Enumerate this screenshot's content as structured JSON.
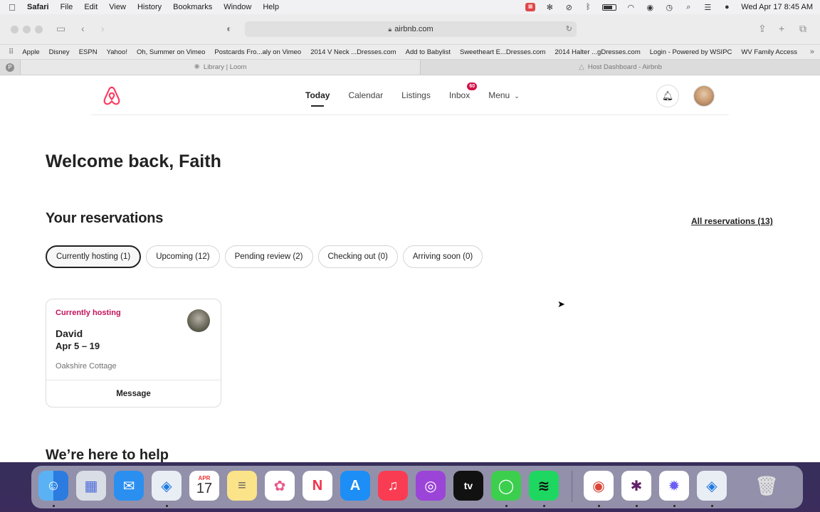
{
  "menubar": {
    "app_name": "Safari",
    "menus": [
      "File",
      "Edit",
      "View",
      "History",
      "Bookmarks",
      "Window",
      "Help"
    ],
    "clock": "Wed Apr 17  8:45 AM"
  },
  "browser": {
    "url": "airbnb.com",
    "bookmarks": [
      "Apple",
      "Disney",
      "ESPN",
      "Yahoo!",
      "Oh, Summer on Vimeo",
      "Postcards Fro...aly on Vimeo",
      "2014 V Neck ...Dresses.com",
      "Add to Babylist",
      "Sweetheart E...Dresses.com",
      "2014 Halter ...gDresses.com",
      "Login - Powered by WSIPC",
      "WV Family Access"
    ],
    "tabs": [
      {
        "title": "Library | Loom"
      },
      {
        "title": "Host Dashboard - Airbnb"
      }
    ]
  },
  "nav": {
    "links": [
      "Today",
      "Calendar",
      "Listings",
      "Inbox",
      "Menu"
    ],
    "inbox_badge": "60",
    "active_link": "Today"
  },
  "main": {
    "welcome": "Welcome back, Faith",
    "reservations_title": "Your reservations",
    "all_reservations": "All reservations (13)",
    "filters": [
      "Currently hosting (1)",
      "Upcoming (12)",
      "Pending review (2)",
      "Checking out (0)",
      "Arriving soon (0)"
    ],
    "card": {
      "status": "Currently hosting",
      "guest": "David",
      "dates": "Apr 5 – 19",
      "listing": "Oakshire Cottage",
      "action": "Message"
    },
    "help_title": "We’re here to help"
  },
  "dock": {
    "calendar_month": "APR",
    "calendar_day": "17"
  },
  "colors": {
    "brand": "#ff385c",
    "status_pink": "#c4135a",
    "badge": "#d31146"
  }
}
